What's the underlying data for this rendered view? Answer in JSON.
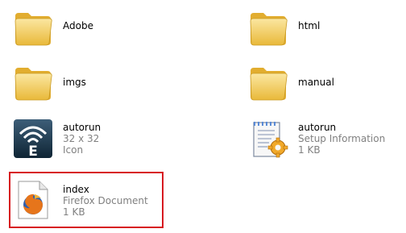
{
  "items": [
    {
      "name": "Adobe",
      "type": "folder",
      "icon": "folder-icon"
    },
    {
      "name": "html",
      "type": "folder",
      "icon": "folder-icon"
    },
    {
      "name": "imgs",
      "type": "folder",
      "icon": "folder-icon"
    },
    {
      "name": "manual",
      "type": "folder",
      "icon": "folder-icon"
    },
    {
      "name": "autorun",
      "detail1": "32 x 32",
      "detail2": "Icon",
      "type": "file",
      "icon": "autorun-e-icon"
    },
    {
      "name": "autorun",
      "detail1": "Setup Information",
      "detail2": "1 KB",
      "type": "file",
      "icon": "setup-information-icon"
    },
    {
      "name": "index",
      "detail1": "Firefox Document",
      "detail2": "1 KB",
      "type": "file",
      "icon": "firefox-document-icon"
    }
  ],
  "colors": {
    "highlight_border": "#d71920",
    "folder_yellow": "#f6d565",
    "detail_text": "#808080"
  }
}
